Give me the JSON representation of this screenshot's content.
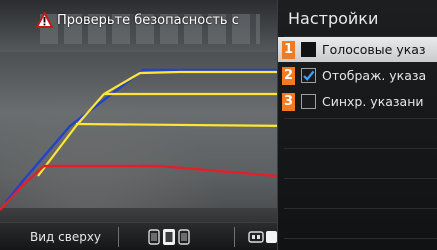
{
  "warning": {
    "text": "Проверьте безопасность с",
    "icon": "warning-triangle-icon"
  },
  "settings": {
    "title": "Настройки",
    "items": [
      {
        "num": "1",
        "label": "Голосовые указ",
        "checked": false,
        "selected": true
      },
      {
        "num": "2",
        "label": "Отображ. указа",
        "checked": true,
        "selected": false
      },
      {
        "num": "3",
        "label": "Синхр. указани",
        "checked": false,
        "selected": false
      }
    ]
  },
  "toolbar": {
    "view_label": "Вид сверху",
    "view_icon": "camera-view-icon",
    "parking_icon": "parking-sensor-icon"
  },
  "colors": {
    "accent": "#f47a20",
    "guide_red": "#e0202a",
    "guide_yellow": "#ffe534",
    "guide_blue": "#2242c8"
  }
}
